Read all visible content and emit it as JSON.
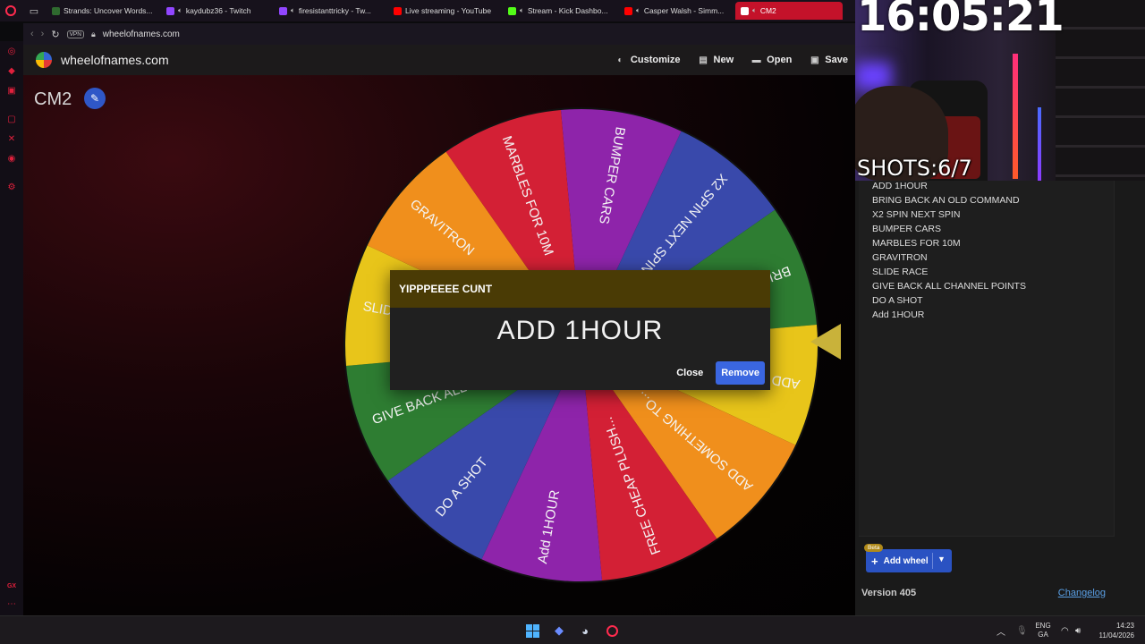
{
  "browser": {
    "tabs": [
      {
        "label": "Strands: Uncover Words...",
        "color": "#2f6a2f",
        "audio": false
      },
      {
        "label": "kaydubz36 - Twitch",
        "color": "#9146ff",
        "audio": true
      },
      {
        "label": "firesistanttricky - Tw...",
        "color": "#9146ff",
        "audio": true
      },
      {
        "label": "Live streaming - YouTube",
        "color": "#ff0000",
        "audio": false
      },
      {
        "label": "Stream - Kick Dashbo...",
        "color": "#53fc18",
        "audio": true
      },
      {
        "label": "Casper Walsh - Simm...",
        "color": "#ff0000",
        "audio": true
      },
      {
        "label": "CM2",
        "color": "#ffffff",
        "audio": true,
        "active": true
      }
    ],
    "vpn_label": "VPN",
    "url": "wheelofnames.com"
  },
  "site": {
    "name": "wheelofnames.com",
    "actions": [
      "Customize",
      "New",
      "Open",
      "Save"
    ]
  },
  "wheel": {
    "title": "CM2",
    "segments": [
      {
        "label": "BUMPER CARS",
        "color": "#8e24aa"
      },
      {
        "label": "X2 SPIN NEXT SPIN",
        "color": "#3949ab"
      },
      {
        "label": "BRING BACK AN OLD...",
        "color": "#2e7d32"
      },
      {
        "label": "ADD 1HOUR",
        "color": "#e8c51a"
      },
      {
        "label": "ADD SOMETHING TO...",
        "color": "#f08f1c"
      },
      {
        "label": "FREE CHEAP PLUSH...",
        "color": "#d32035"
      },
      {
        "label": "Add 1HOUR",
        "color": "#8e24aa"
      },
      {
        "label": "DO A SHOT",
        "color": "#3949ab"
      },
      {
        "label": "GIVE BACK ALL CHA...",
        "color": "#2e7d32"
      },
      {
        "label": "SLIDE RACE",
        "color": "#e8c51a"
      },
      {
        "label": "GRAVITRON",
        "color": "#f08f1c"
      },
      {
        "label": "MARBLES FOR 10M",
        "color": "#d32035"
      }
    ],
    "pointer_color": "#c9b23a"
  },
  "dialog": {
    "title": "YIPPPEEEE CUNT",
    "winner": "ADD 1HOUR",
    "close_label": "Close",
    "remove_label": "Remove"
  },
  "overlay": {
    "clock": "16:05:21",
    "shots": "SHOTS:6/7"
  },
  "entries": {
    "items": [
      "ADD 1HOUR",
      "BRING BACK AN OLD COMMAND",
      "X2 SPIN NEXT SPIN",
      "BUMPER CARS",
      "MARBLES FOR 10M",
      "GRAVITRON",
      "SLIDE RACE",
      "GIVE BACK ALL CHANNEL POINTS",
      "DO A SHOT",
      "Add 1HOUR"
    ],
    "beta_label": "Beta",
    "add_wheel_label": "Add wheel",
    "version": "Version 405",
    "changelog": "Changelog"
  },
  "taskbar": {
    "lang_top": "ENG",
    "lang_bottom": "GA",
    "time": "14:23",
    "date": "11/04/2026"
  },
  "sidebar": {
    "bottom_label": "GX"
  }
}
